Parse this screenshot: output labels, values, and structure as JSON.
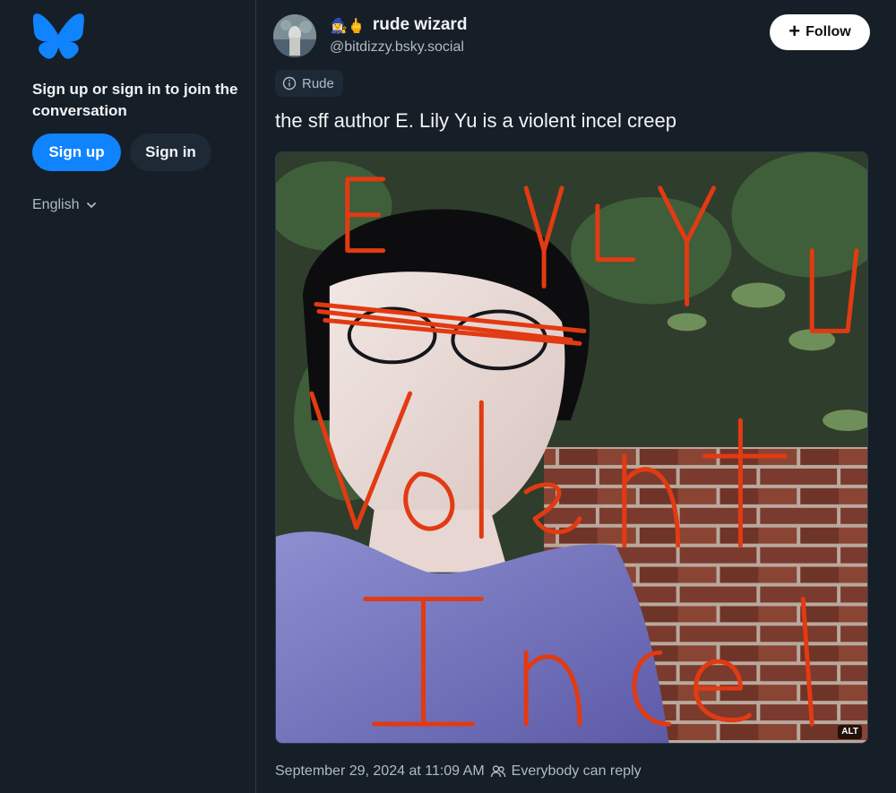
{
  "sidebar": {
    "logo_icon": "bluesky-butterfly-icon",
    "join_text": "Sign up or sign in to join the conversation",
    "signup_label": "Sign up",
    "signin_label": "Sign in",
    "language": "English"
  },
  "post": {
    "author": {
      "emoji": "🧙‍♀️🖕",
      "name": "rude wizard",
      "handle": "@bitdizzy.bsky.social"
    },
    "follow_label": "Follow",
    "label_badge": "Rude",
    "text": "the sff author E. Lily Yu is a violent incel creep",
    "image_alt_badge": "ALT",
    "timestamp": "September 29, 2024 at 11:09 AM",
    "reply_setting": "Everybody can reply"
  },
  "colors": {
    "background": "#161e27",
    "accent": "#1083fe",
    "muted_text": "#aebbc9",
    "surface": "#1e2936"
  }
}
